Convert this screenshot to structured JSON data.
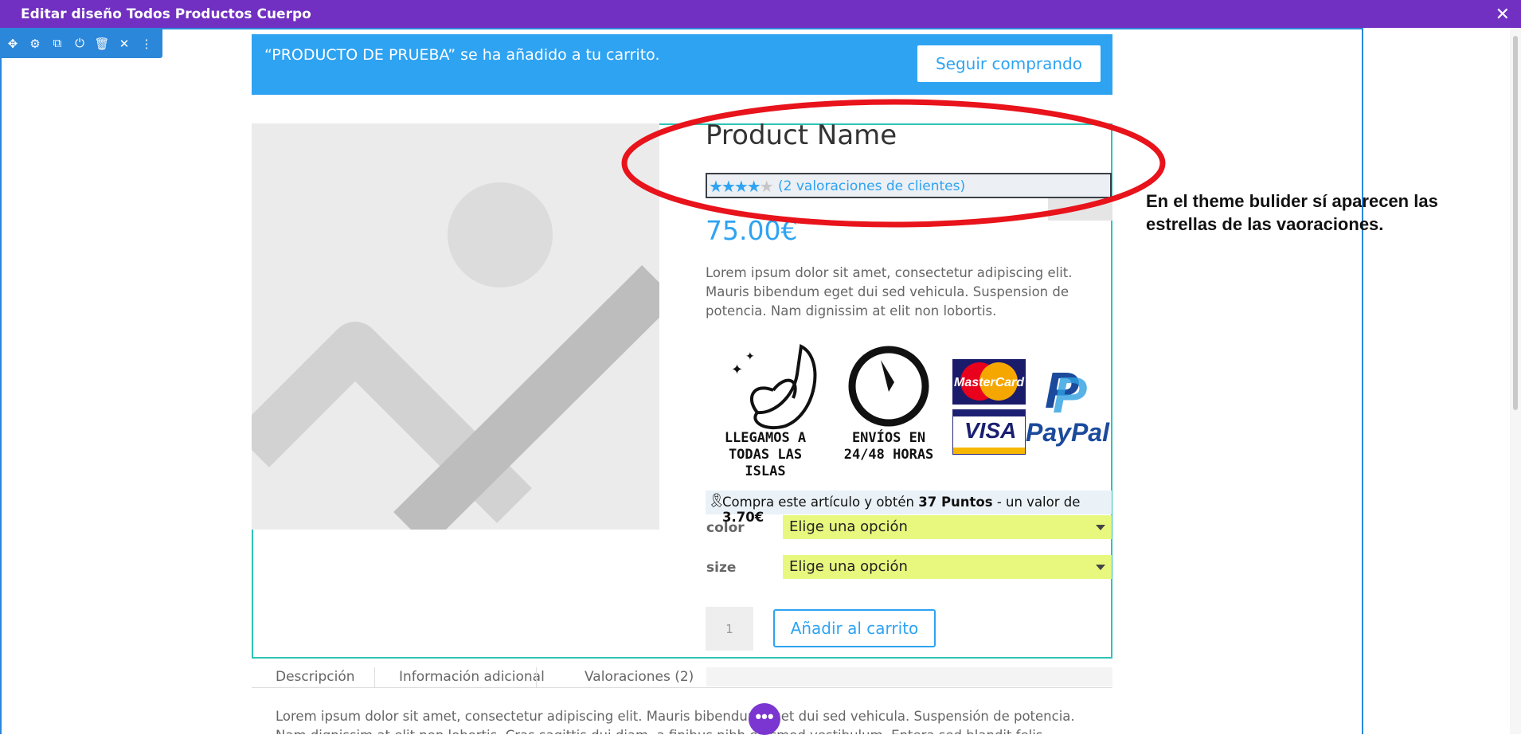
{
  "titlebar": {
    "title": "Editar diseño Todos Productos Cuerpo",
    "close_icon": "close-icon"
  },
  "module_toolbar": {
    "icons": [
      "move-icon",
      "gear-icon",
      "duplicate-icon",
      "power-icon",
      "trash-icon",
      "close-icon",
      "more-vertical-icon"
    ]
  },
  "notice": {
    "message": "“PRODUCTO DE PRUEBA” se ha añadido a tu carrito.",
    "button": "Seguir comprando"
  },
  "product": {
    "name": "Product Name",
    "rating": {
      "stars_filled": 4,
      "stars_total": 5,
      "reviews_label": "(2 valoraciones de clientes)"
    },
    "price": "75.00€",
    "description": "Lorem ipsum dolor sit amet, consectetur adipiscing elit. Mauris bibendum eget dui sed vehicula. Suspension de potencia. Nam dignissim at elit non lobortis.",
    "badges": {
      "islands": "LLEGAMOS A\nTODAS LAS ISLAS",
      "shipping": "ENVÍOS EN\n24/48 HORAS",
      "mastercard": "MasterCard",
      "visa": "VISA",
      "paypal": "PayPal"
    },
    "points": {
      "prefix": "Compra este artículo y obtén ",
      "points": "37 Puntos",
      "middle": " - un valor de ",
      "value": "3.70€"
    },
    "variations": [
      {
        "label": "color",
        "value": "Elige una opción"
      },
      {
        "label": "size",
        "value": "Elige una opción"
      }
    ],
    "quantity": "1",
    "add_to_cart": "Añadir al carrito"
  },
  "tabs": [
    {
      "label": "Descripción"
    },
    {
      "label": "Información adicional"
    },
    {
      "label": "Valoraciones (2)"
    }
  ],
  "tab_content": "Lorem ipsum dolor sit amet, consectetur adipiscing elit. Mauris bibendum eget dui sed vehicula. Suspensión de potencia.",
  "tab_content_line2": "Nam dignissim at elit non lobortis. Cras sagittis dui diam, a finibus nibh euismod vestibulum. Entera sed blandit felis.",
  "fab": {
    "label": "•••"
  },
  "annotation": {
    "text": "En el theme bulider sí aparecen las estrellas de las vaoraciones.",
    "color": "#e8131b"
  },
  "colors": {
    "accent": "#2ea3f2",
    "titlebar": "#7130c1",
    "select_bg": "#e8f87e",
    "module_border": "#2ec4b6"
  }
}
